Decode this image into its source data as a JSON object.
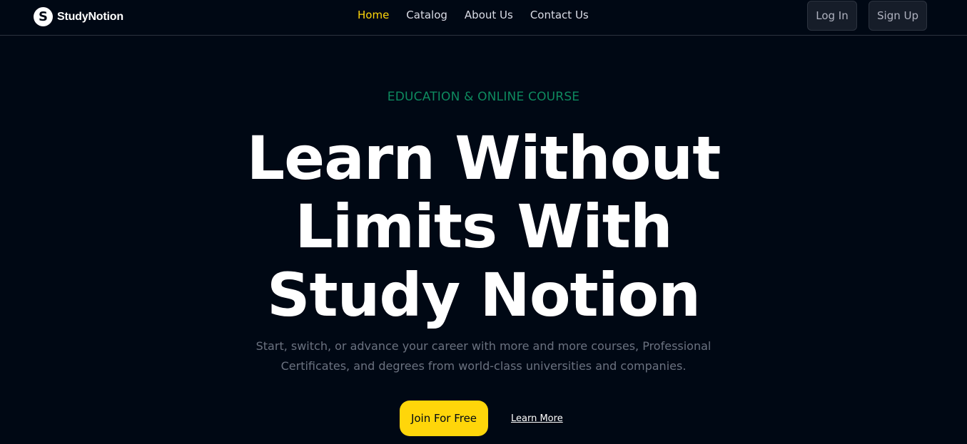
{
  "brand": {
    "logo_letter": "S",
    "name": "StudyNotion",
    "icon": "studynotion-logo-icon"
  },
  "nav": {
    "links": [
      {
        "label": "Home",
        "active": true
      },
      {
        "label": "Catalog",
        "active": false
      },
      {
        "label": "About Us",
        "active": false
      },
      {
        "label": "Contact Us",
        "active": false
      }
    ],
    "login_label": "Log In",
    "signup_label": "Sign Up"
  },
  "hero": {
    "kicker": "EDUCATION & ONLINE COURSE",
    "headline_lines": [
      "Learn Without",
      "Limits With",
      "Study Notion"
    ],
    "subtext_lines": [
      "Start, switch, or advance your career with more and more courses, Professional",
      "Certificates, and degrees from world-class universities and companies."
    ],
    "primary_cta": "Join For Free",
    "secondary_cta": "Learn More"
  },
  "colors": {
    "background": "#000814",
    "accent": "#ffd60a",
    "kicker": "#0e8a5f",
    "muted_text": "#6b7280",
    "button_bg": "#161d29"
  }
}
